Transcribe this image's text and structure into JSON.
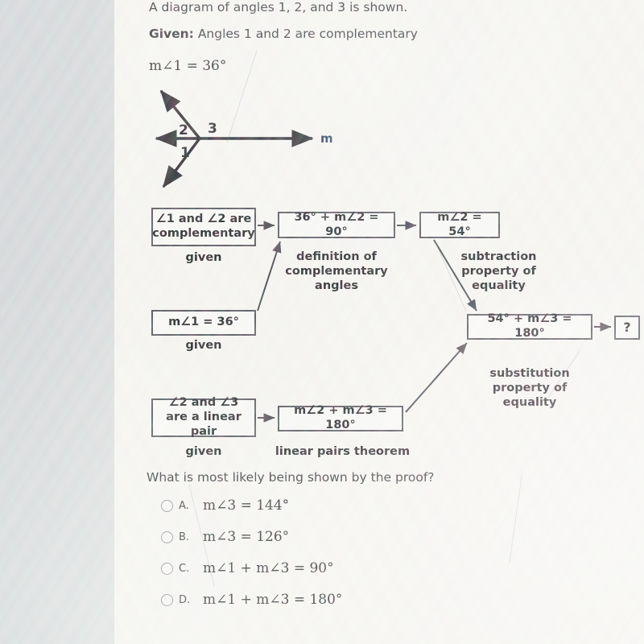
{
  "question": {
    "intro": "A diagram of angles 1, 2, and 3 is shown.",
    "given_label": "Given:",
    "given_text": "Angles 1 and 2 are complementary",
    "given_measure": "m∠1 = 36°",
    "prompt": "What is most likely being shown by the proof?"
  },
  "diagram": {
    "angle_label_1": "1",
    "angle_label_2": "2",
    "angle_label_3": "3",
    "line_label": "m"
  },
  "proof": {
    "boxes": [
      {
        "id": "b1",
        "text": "∠1 and ∠2 are complementary",
        "reason": "given"
      },
      {
        "id": "b2",
        "text": "36° + m∠2 = 90°",
        "reason": "definition of complementary angles"
      },
      {
        "id": "b3",
        "text": "m∠2 = 54°",
        "reason": "subtraction property of equality"
      },
      {
        "id": "b4",
        "text": "m∠1 = 36°",
        "reason": "given"
      },
      {
        "id": "b5",
        "text": "54° + m∠3 = 180°",
        "reason": "substitution property of equality"
      },
      {
        "id": "b6",
        "text": "∠2 and ∠3 are a linear pair",
        "reason": "given"
      },
      {
        "id": "b7",
        "text": "m∠2 + m∠3 = 180°",
        "reason": "linear pairs theorem"
      },
      {
        "id": "b8",
        "text": "?",
        "reason": ""
      }
    ]
  },
  "options": [
    {
      "letter": "A.",
      "text": "m∠3 = 144°",
      "selected": false
    },
    {
      "letter": "B.",
      "text": "m∠3 = 126°",
      "selected": false
    },
    {
      "letter": "C.",
      "text": "m∠1 + m∠3 = 90°",
      "selected": false
    },
    {
      "letter": "D.",
      "text": "m∠1 + m∠3 = 180°",
      "selected": false
    }
  ],
  "colors": {
    "page": "#f3f2ee",
    "margin": "#ced1d3",
    "ink": "#17171b",
    "box_border": "#4a4a52",
    "line_label": "#1b2a52"
  }
}
